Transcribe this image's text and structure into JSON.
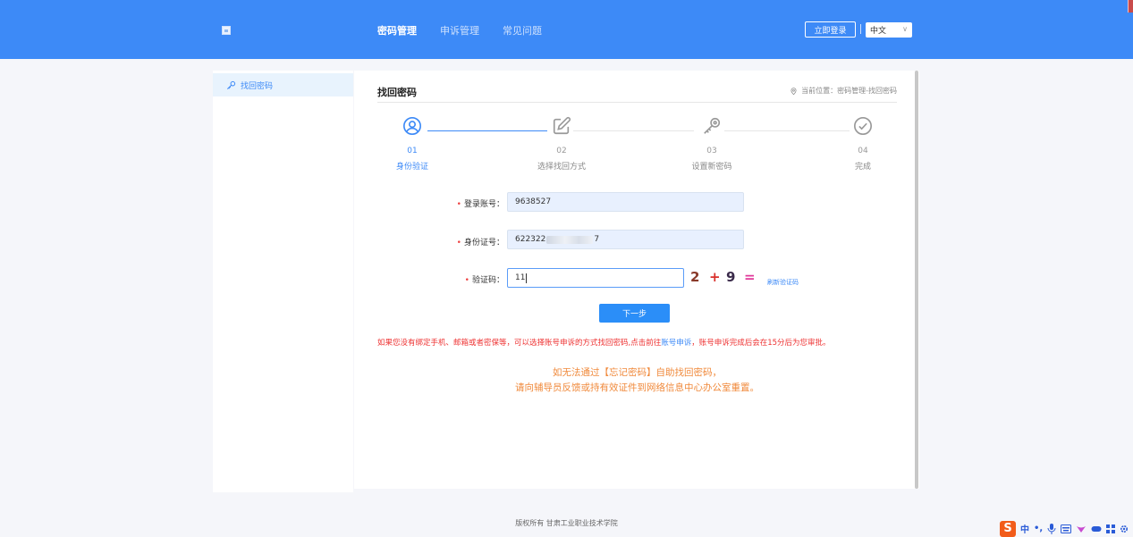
{
  "header": {
    "nav": [
      "密码管理",
      "申诉管理",
      "常见问题"
    ],
    "active_nav": 0,
    "login_label": "立即登录",
    "language": "中文"
  },
  "sidebar": {
    "items": [
      {
        "label": "找回密码",
        "icon": "key-icon"
      }
    ]
  },
  "panel": {
    "title": "找回密码",
    "breadcrumb": "当前位置：密码管理-找回密码"
  },
  "steps": [
    {
      "num": "01",
      "label": "身份验证",
      "icon": "user-circle-icon",
      "active": true
    },
    {
      "num": "02",
      "label": "选择找回方式",
      "icon": "edit-icon",
      "active": false
    },
    {
      "num": "03",
      "label": "设置新密码",
      "icon": "key-icon",
      "active": false
    },
    {
      "num": "04",
      "label": "完成",
      "icon": "check-circle-icon",
      "active": false
    }
  ],
  "form": {
    "account_label": "登录账号：",
    "account_value": "9638527",
    "id_label": "身份证号：",
    "id_value_prefix": "622322",
    "id_value_suffix": "7",
    "captcha_label": "验证码：",
    "captcha_value": "11",
    "captcha_expr": {
      "a": "2",
      "op": "+",
      "b": "9",
      "eq": "="
    },
    "refresh_label": "刷新验证码",
    "next_label": "下一步"
  },
  "notice": {
    "text_before": "如果您没有绑定手机、邮箱或者密保等，可以选择账号申诉的方式找回密码,点击前往",
    "link_text": "账号申诉",
    "text_after": "，账号申诉完成后会在15分后为您审批。"
  },
  "orange_note": {
    "line1": "如无法通过【忘记密码】自助找回密码，",
    "line2": "请向辅导员反馈或持有效证件到网络信息中心办公室重置。"
  },
  "footer": "版权所有 甘肃工业职业技术学院",
  "colors": {
    "brand": "#3d8af7",
    "warning": "#ee3333",
    "note": "#f08a3c"
  },
  "ime": {
    "logo": "S",
    "mode": "中",
    "punct": "•,"
  }
}
